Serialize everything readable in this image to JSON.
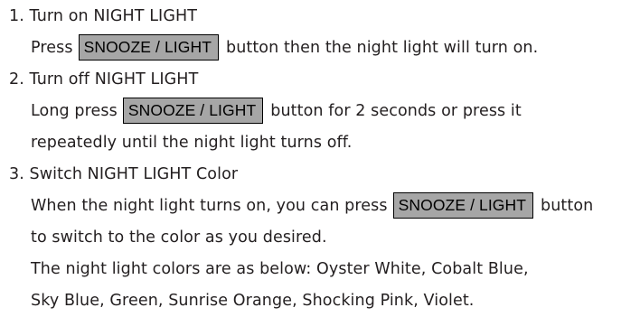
{
  "steps": [
    {
      "title": "1. Turn on NIGHT LIGHT",
      "lines": [
        {
          "before": "Press",
          "button": "SNOOZE / LIGHT",
          "after": "button then the night light will turn on."
        }
      ]
    },
    {
      "title": "2. Turn off NIGHT LIGHT",
      "lines": [
        {
          "before": "Long press",
          "button": "SNOOZE / LIGHT",
          "after": "button for 2 seconds or press it"
        },
        {
          "text": "repeatedly until the night light turns off."
        }
      ]
    },
    {
      "title": "3. Switch NIGHT LIGHT Color",
      "lines": [
        {
          "before": "When the night light turns on, you can press",
          "button": "SNOOZE / LIGHT",
          "after": "button"
        },
        {
          "text": "to switch to the color as you desired."
        },
        {
          "text": "The night light colors are as below: Oyster White, Cobalt Blue,"
        },
        {
          "text": "Sky Blue, Green, Sunrise Orange, Shocking Pink, Violet."
        }
      ]
    }
  ],
  "colors": {
    "text": "#231f20",
    "button_fill": "#a6a6a6",
    "button_border": "#000000"
  }
}
